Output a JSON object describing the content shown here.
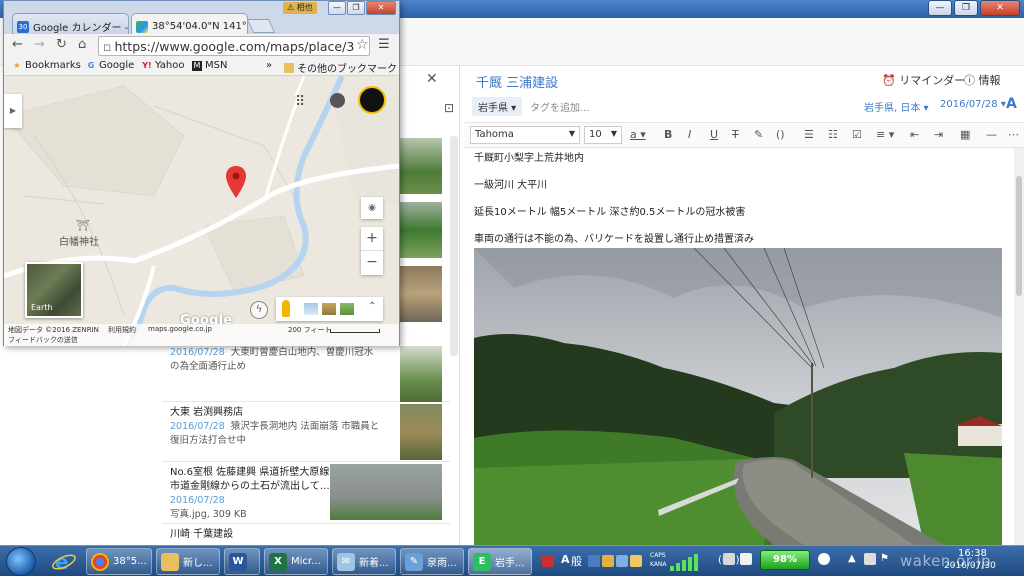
{
  "chrome": {
    "tabs": [
      {
        "label": "Google カレンダー - ",
        "favicon_text": "30",
        "active": false
      },
      {
        "label": "38°54'04.0\"N 141°2",
        "active": true
      }
    ],
    "user_badge": "相也",
    "address_bar": "https://www.google.com/maps/place/3",
    "bookmarks": [
      {
        "label": "Bookmarks",
        "icon": "star-icon"
      },
      {
        "label": "Google",
        "icon": "google-icon"
      },
      {
        "label": "Yahoo",
        "icon": "yahoo-icon"
      },
      {
        "label": "MSN",
        "icon": "msn-icon"
      }
    ],
    "bookmarks_overflow": "»",
    "other_bookmarks": "その他のブックマーク"
  },
  "map": {
    "place_label": "白幡神社",
    "earth_label": "Earth",
    "logo": "Google",
    "footer": {
      "map_data": "地図データ ©2016 ZENRIN",
      "terms": "利用規約",
      "domain": "maps.google.co.jp",
      "scale": "200 フィート",
      "feedback": "フィードバックの送信"
    }
  },
  "notelist": {
    "items": [
      {
        "title": "",
        "date": "2016/07/28",
        "snippet": "大東町曽慶白山地内、曽慶川冠水の為全面通行止め"
      },
      {
        "title": "大東 岩渕興務店",
        "date": "2016/07/28",
        "snippet": "猿沢字長洞地内 法面崩落 市職員と復旧方法打合せ中"
      },
      {
        "title": "No.6室根 佐藤建興 県道折壁大原線 市道金剛線からの土石が流出して…",
        "date": "2016/07/28",
        "snippet": "写真.jpg, 309 KB"
      },
      {
        "title": "川崎 千葉建設",
        "date": "",
        "snippet": ""
      }
    ]
  },
  "editor": {
    "title": "千厩 三浦建設",
    "reminder": "リマインダー",
    "info": "情報",
    "notebook": "岩手県 ▾",
    "tag_placeholder": "タグを追加...",
    "location": "岩手県, 日本 ▾",
    "date": "2016/07/28 ▾",
    "font_name": "Tahoma",
    "font_size": "10",
    "body": [
      "千厩町小梨字上荒井地内",
      "一級河川 大平川",
      "延長10メートル 幅5メートル 深さ約0.5メートルの冠水被害",
      "車両の通行は不能の為、バリケードを設置し通行止め措置済み"
    ]
  },
  "taskbar": {
    "buttons": [
      {
        "label": "38°5...",
        "icon": "chrome-icon"
      },
      {
        "label": "新し...",
        "icon": "folder-icon"
      },
      {
        "label": "",
        "icon": "word-icon"
      },
      {
        "label": "Micr...",
        "icon": "excel-icon"
      },
      {
        "label": "新着...",
        "icon": "mail-icon"
      },
      {
        "label": "泉雨...",
        "icon": "app-icon"
      },
      {
        "label": "岩手...",
        "icon": "evernote-icon"
      }
    ],
    "ime_a": "A",
    "ime_kanji": "般",
    "caps": "CAPS KANA",
    "battery": "98%",
    "time": "16:38",
    "date": "2016/07/30",
    "watermark": "waken.or.jp"
  }
}
